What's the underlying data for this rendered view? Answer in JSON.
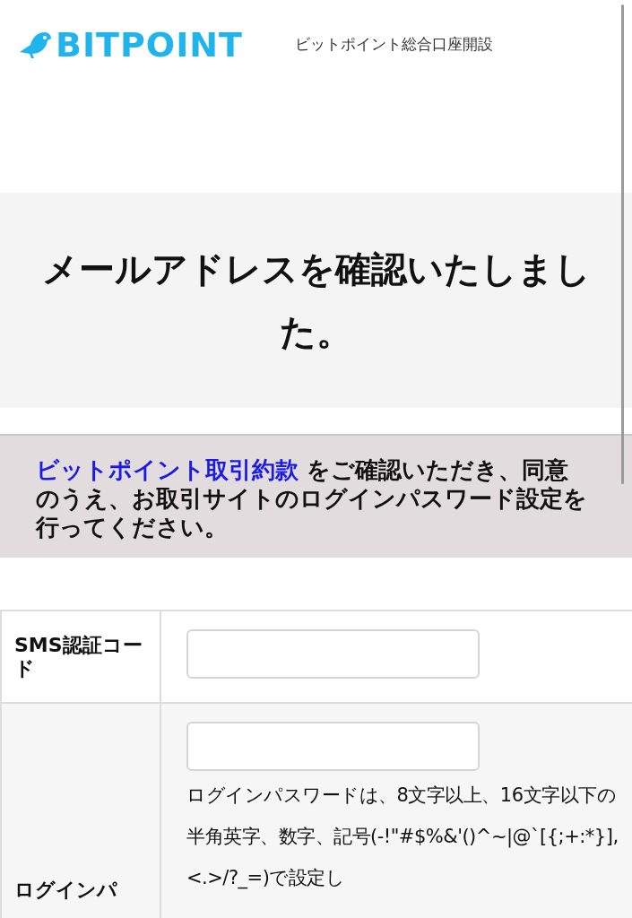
{
  "header": {
    "logo_text": "BITPOINT",
    "subtitle": "ビットポイント総合口座開設"
  },
  "heading": "メールアドレスを確認いたしました。",
  "notice": {
    "link": "ビットポイント取引約款",
    "text": " をご確認いただき、同意のうえ、お取引サイトのログインパスワード設定を行ってください。"
  },
  "form": {
    "rows": [
      {
        "label": "SMS認証コード"
      },
      {
        "label": "ログインパ",
        "help": "ログインパスワードは、8文字以上、16文字以下の半角英字、数字、記号(-!\"#$%&'()^~|@`[{;+:*}],<.>/?_=)で設定し"
      }
    ]
  }
}
